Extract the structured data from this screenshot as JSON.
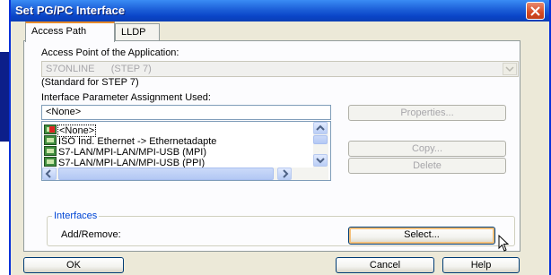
{
  "window": {
    "title": "Set PG/PC Interface"
  },
  "tabs": [
    {
      "label": "Access Path"
    },
    {
      "label": "LLDP"
    }
  ],
  "access_point": {
    "label": "Access Point of the Application:",
    "value": "S7ONLINE      (STEP 7)",
    "description": "(Standard for STEP 7)"
  },
  "interface_param": {
    "label": "Interface Parameter Assignment Used:",
    "value": "<None>",
    "items": [
      {
        "label": "<None>"
      },
      {
        "label": "ISO Ind. Ethernet -> Ethernetadapte"
      },
      {
        "label": "S7-LAN/MPI-LAN/MPI-USB (MPI)"
      },
      {
        "label": "S7-LAN/MPI-LAN/MPI-USB (PPI)"
      }
    ]
  },
  "side_buttons": {
    "properties": "Properties...",
    "copy": "Copy...",
    "delete": "Delete"
  },
  "interfaces": {
    "legend": "Interfaces",
    "add_remove_label": "Add/Remove:",
    "select_button": "Select..."
  },
  "footer": {
    "ok": "OK",
    "cancel": "Cancel",
    "help": "Help"
  },
  "colors": {
    "title_bar": "#0a45c8",
    "dialog_bg": "#ece9d8",
    "close_button": "#d54a24",
    "legend_text": "#0046d5"
  },
  "icons": [
    "close-icon",
    "network-adapter-icon",
    "dropdown-arrow-icon",
    "scroll-arrow-icon",
    "mouse-cursor-icon"
  ]
}
